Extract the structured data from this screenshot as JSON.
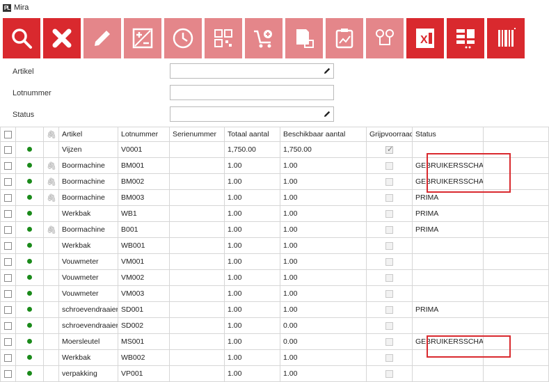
{
  "app": {
    "title": "Mira",
    "logo": "PL"
  },
  "colors": {
    "accent": "#d9292e",
    "accent_disabled": "#e4868a",
    "status_dot": "#1a8a1a"
  },
  "toolbar": [
    {
      "name": "search-button",
      "icon": "search-icon",
      "enabled": true
    },
    {
      "name": "clear-button",
      "icon": "close-icon",
      "enabled": true
    },
    {
      "name": "edit-button",
      "icon": "pencil-icon",
      "enabled": false
    },
    {
      "name": "plus-minus-button",
      "icon": "plus-minus-icon",
      "enabled": false
    },
    {
      "name": "history-button",
      "icon": "clock-icon",
      "enabled": false
    },
    {
      "name": "qr-code-button",
      "icon": "qr-code-icon",
      "enabled": false
    },
    {
      "name": "add-to-cart-button",
      "icon": "cart-add-icon",
      "enabled": false
    },
    {
      "name": "document-box-button",
      "icon": "document-box-icon",
      "enabled": false
    },
    {
      "name": "clipboard-chart-button",
      "icon": "clipboard-chart-icon",
      "enabled": false
    },
    {
      "name": "route-button",
      "icon": "location-route-icon",
      "enabled": false
    },
    {
      "name": "excel-export-button",
      "icon": "excel-icon",
      "enabled": true
    },
    {
      "name": "column-settings-button",
      "icon": "columns-settings-icon",
      "enabled": true
    },
    {
      "name": "barcode-button",
      "icon": "barcode-icon",
      "enabled": true
    }
  ],
  "filters": {
    "artikel": {
      "label": "Artikel",
      "value": ""
    },
    "lotnummer": {
      "label": "Lotnummer",
      "value": ""
    },
    "status": {
      "label": "Status",
      "value": ""
    }
  },
  "grid": {
    "columns": [
      "",
      "",
      "",
      "Artikel",
      "Lotnummer",
      "Serienummer",
      "Totaal aantal",
      "Beschikbaar aantal",
      "Grijpvoorraad",
      "Status"
    ],
    "rows": [
      {
        "artikel": "Vijzen",
        "lot": "V0001",
        "serie": "",
        "totaal": "1,750.00",
        "beschikbaar": "1,750.00",
        "grijp": true,
        "status": "",
        "clip": false
      },
      {
        "artikel": "Boormachine",
        "lot": "BM001",
        "serie": "",
        "totaal": "1.00",
        "beschikbaar": "1.00",
        "grijp": false,
        "status": "GEBRUIKERSSCHADE",
        "clip": true
      },
      {
        "artikel": "Boormachine",
        "lot": "BM002",
        "serie": "",
        "totaal": "1.00",
        "beschikbaar": "1.00",
        "grijp": false,
        "status": "GEBRUIKERSSCHADE",
        "clip": true
      },
      {
        "artikel": "Boormachine",
        "lot": "BM003",
        "serie": "",
        "totaal": "1.00",
        "beschikbaar": "1.00",
        "grijp": false,
        "status": "PRIMA",
        "clip": true
      },
      {
        "artikel": "Werkbak",
        "lot": "WB1",
        "serie": "",
        "totaal": "1.00",
        "beschikbaar": "1.00",
        "grijp": false,
        "status": "PRIMA",
        "clip": false
      },
      {
        "artikel": "Boormachine",
        "lot": "B001",
        "serie": "",
        "totaal": "1.00",
        "beschikbaar": "1.00",
        "grijp": false,
        "status": "PRIMA",
        "clip": true
      },
      {
        "artikel": "Werkbak",
        "lot": "WB001",
        "serie": "",
        "totaal": "1.00",
        "beschikbaar": "1.00",
        "grijp": false,
        "status": "",
        "clip": false
      },
      {
        "artikel": "Vouwmeter",
        "lot": "VM001",
        "serie": "",
        "totaal": "1.00",
        "beschikbaar": "1.00",
        "grijp": false,
        "status": "",
        "clip": false
      },
      {
        "artikel": "Vouwmeter",
        "lot": "VM002",
        "serie": "",
        "totaal": "1.00",
        "beschikbaar": "1.00",
        "grijp": false,
        "status": "",
        "clip": false
      },
      {
        "artikel": "Vouwmeter",
        "lot": "VM003",
        "serie": "",
        "totaal": "1.00",
        "beschikbaar": "1.00",
        "grijp": false,
        "status": "",
        "clip": false
      },
      {
        "artikel": "schroevendraaier",
        "lot": "SD001",
        "serie": "",
        "totaal": "1.00",
        "beschikbaar": "1.00",
        "grijp": false,
        "status": "PRIMA",
        "clip": false
      },
      {
        "artikel": "schroevendraaier",
        "lot": "SD002",
        "serie": "",
        "totaal": "1.00",
        "beschikbaar": "0.00",
        "grijp": false,
        "status": "",
        "clip": false
      },
      {
        "artikel": "Moersleutel",
        "lot": "MS001",
        "serie": "",
        "totaal": "1.00",
        "beschikbaar": "0.00",
        "grijp": false,
        "status": "GEBRUIKERSSCHADE",
        "clip": false
      },
      {
        "artikel": "Werkbak",
        "lot": "WB002",
        "serie": "",
        "totaal": "1.00",
        "beschikbaar": "1.00",
        "grijp": false,
        "status": "",
        "clip": false
      },
      {
        "artikel": "verpakking",
        "lot": "VP001",
        "serie": "",
        "totaal": "1.00",
        "beschikbaar": "1.00",
        "grijp": false,
        "status": "",
        "clip": false
      }
    ]
  }
}
